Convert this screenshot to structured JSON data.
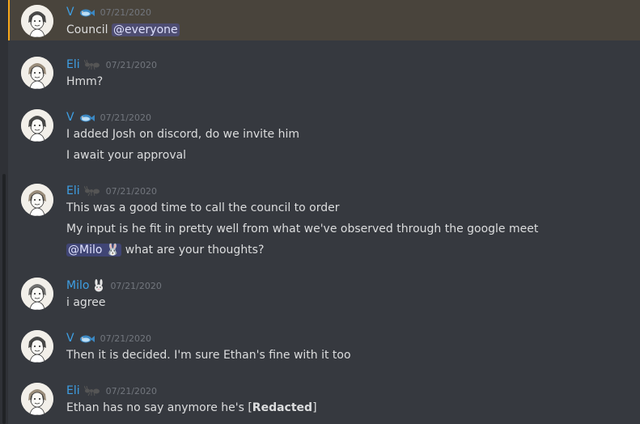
{
  "messages": [
    {
      "author": "V",
      "badge": "fish-emoji",
      "timestamp": "07/21/2020",
      "highlighted": true,
      "lines": [
        {
          "parts": [
            {
              "text": "Council "
            },
            {
              "mention": "@everyone"
            }
          ]
        }
      ]
    },
    {
      "author": "Eli",
      "badge": "ant-emoji",
      "timestamp": "07/21/2020",
      "lines": [
        {
          "parts": [
            {
              "text": "Hmm?"
            }
          ]
        }
      ]
    },
    {
      "author": "V",
      "badge": "fish-emoji",
      "timestamp": "07/21/2020",
      "lines": [
        {
          "parts": [
            {
              "text": "I added Josh on discord, do we invite him"
            }
          ]
        },
        {
          "parts": [
            {
              "text": "I await your approval"
            }
          ]
        }
      ]
    },
    {
      "author": "Eli",
      "badge": "ant-emoji",
      "timestamp": "07/21/2020",
      "lines": [
        {
          "parts": [
            {
              "text": "This was a good time to call the council to order"
            }
          ]
        },
        {
          "parts": [
            {
              "text": "My input is he fit in pretty well from what we've observed through the google meet"
            }
          ]
        },
        {
          "parts": [
            {
              "mention": "@Milo 🐰"
            },
            {
              "text": " what are your thoughts?"
            }
          ]
        }
      ]
    },
    {
      "author": "Milo",
      "badge": "rabbit-emoji",
      "timestamp": "07/21/2020",
      "lines": [
        {
          "parts": [
            {
              "text": "i agree"
            }
          ]
        }
      ]
    },
    {
      "author": "V",
      "badge": "fish-emoji",
      "timestamp": "07/21/2020",
      "lines": [
        {
          "parts": [
            {
              "text": "Then it is decided. I'm sure Ethan's fine with it too"
            }
          ]
        }
      ]
    },
    {
      "author": "Eli",
      "badge": "ant-emoji",
      "timestamp": "07/21/2020",
      "lines": [
        {
          "parts": [
            {
              "text": "Ethan has no say anymore he's ["
            },
            {
              "bold": "Redacted"
            },
            {
              "text": "]"
            }
          ]
        }
      ]
    }
  ],
  "colors": {
    "background": "#36393f",
    "username": "#3e9fe4",
    "timestamp": "#72767d",
    "mention_highlight_bg": "#49443c",
    "mention_highlight_border": "#faa81a",
    "mention_pill_text": "#dee0fc"
  }
}
